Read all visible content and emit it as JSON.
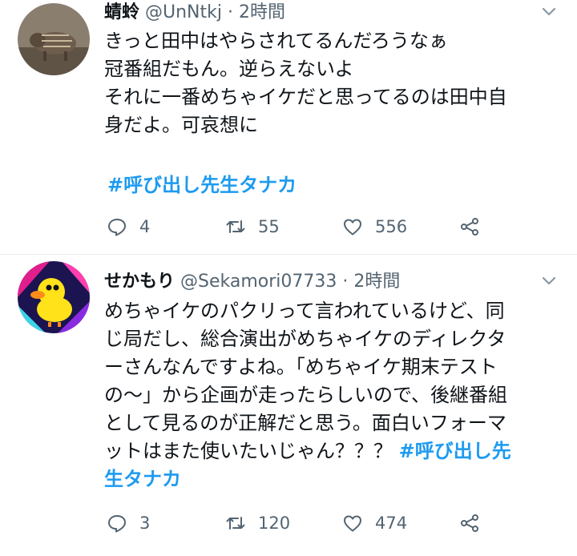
{
  "tweets": [
    {
      "display_name": "蜻蛉",
      "handle": "@UnNtkj",
      "separator": "·",
      "time": "2時間",
      "lines": [
        "きっと田中はやらされてるんだろうなぁ",
        "冠番組だもん。逆らえないよ",
        "それに一番めちゃイケだと思ってるのは田中自",
        "身だよ。可哀想に"
      ],
      "hashtag": "#呼び出し先生タナカ",
      "reply_count": "4",
      "retweet_count": "55",
      "like_count": "556"
    },
    {
      "display_name": "せかもり",
      "handle": "@Sekamori07733",
      "separator": "·",
      "time": "2時間",
      "lines": [
        "めちゃイケのパクリって言われているけど、同",
        "じ局だし、総合演出がめちゃイケのディレクタ",
        "ーさんなんですよね。「めちゃイケ期末テスト",
        "の〜」から企画が走ったらしいので、後継番組",
        "として見るのが正解だと思う。面白いフォーマ",
        "ットはまた使いたいじゃん？？？"
      ],
      "hashtag_part1": "#呼び出し先",
      "hashtag_part2": "生タナカ",
      "reply_count": "3",
      "retweet_count": "120",
      "like_count": "474"
    }
  ],
  "icons": {
    "reply": "reply-icon",
    "retweet": "retweet-icon",
    "like": "heart-icon",
    "share": "share-icon",
    "more": "chevron-down-icon"
  },
  "colors": {
    "hashtag": "#1d9bf0",
    "muted": "#536471",
    "text": "#0f1419",
    "divider": "#e6ecf0"
  }
}
